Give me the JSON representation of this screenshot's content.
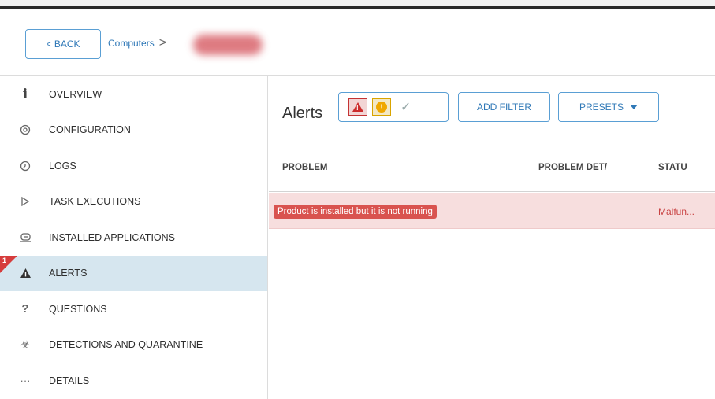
{
  "breadcrumb": {
    "back_label": "< BACK",
    "computers_label": "Computers",
    "separator": ">"
  },
  "sidebar": {
    "items": [
      {
        "label": "OVERVIEW",
        "icon": "info-icon"
      },
      {
        "label": "CONFIGURATION",
        "icon": "settings-icon"
      },
      {
        "label": "LOGS",
        "icon": "clock-icon"
      },
      {
        "label": "TASK EXECUTIONS",
        "icon": "play-icon"
      },
      {
        "label": "INSTALLED APPLICATIONS",
        "icon": "install-icon"
      },
      {
        "label": "ALERTS",
        "icon": "warning-icon",
        "active": true,
        "badge": "1"
      },
      {
        "label": "QUESTIONS",
        "icon": "question-icon"
      },
      {
        "label": "DETECTIONS AND QUARANTINE",
        "icon": "biohazard-icon"
      },
      {
        "label": "DETAILS",
        "icon": "ellipsis-icon"
      }
    ]
  },
  "main": {
    "title": "Alerts",
    "filters": {
      "error_symbol": "!",
      "warning_symbol": "!",
      "ok_symbol": "✓"
    },
    "add_filter_label": "ADD FILTER",
    "presets_label": "PRESETS",
    "columns": [
      "PROBLEM",
      "PROBLEM DET/",
      "STATU"
    ],
    "rows": [
      {
        "problem": "Product is installed but it is not running",
        "details": "",
        "status": "Malfun..."
      }
    ]
  },
  "colors": {
    "accent": "#2f78b7",
    "alert_red": "#d9534f",
    "row_highlight": "#f7dede",
    "active_nav": "#d6e6ef"
  }
}
